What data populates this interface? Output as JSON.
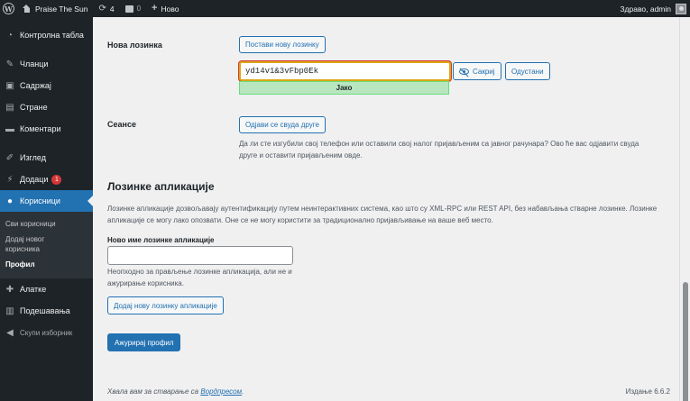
{
  "adminbar": {
    "site_name": "Praise The Sun",
    "updates_count": "4",
    "comments_count": "0",
    "new_label": "Ново",
    "greeting": "Здраво, admin"
  },
  "sidebar": {
    "dashboard": "Контролна табла",
    "posts": "Чланци",
    "media": "Садржај",
    "pages": "Стране",
    "comments": "Коментари",
    "appearance": "Изглед",
    "plugins": "Додаци",
    "plugins_badge": "1",
    "users": "Корисници",
    "submenu": {
      "all_users": "Сви корисници",
      "add_new": "Додај новог корисника",
      "profile": "Профил"
    },
    "tools": "Алатке",
    "settings": "Подешавања",
    "collapse": "Скупи изборник"
  },
  "content": {
    "new_password_label": "Нова лозинка",
    "set_new_password_button": "Постави нову лозинку",
    "password_value": "yd14v1&3vFbp0Ek",
    "hide_button": "Сакриј",
    "cancel_button": "Одустани",
    "strength_label": "Јако",
    "sessions_label": "Сеансе",
    "logout_everywhere_button": "Одјави се свуда друге",
    "sessions_desc": "Да ли сте изгубили свој телефон или оставили свој налог пријављеним са јавног рачунара? Ово ће вас одјавити свуда друге и оставити пријављеним овде.",
    "app_passwords_heading": "Лозинке апликације",
    "app_passwords_desc": "Лозинке апликације дозвољавају аутентификацију путем неинтерактивних система, као што су XML-RPC или REST API, без набављања стварне лозинке. Лозинке апликације се могу лако опозвати. Оне се не могу користити за традиционално пријављивање на ваше веб место.",
    "new_app_password_label": "Ново име лозинке апликације",
    "new_app_password_value": "",
    "new_app_password_hint": "Неопходно за прављење лозинке апликација, али не и ажурирање корисника.",
    "add_app_password_button": "Додај нову лозинку апликације",
    "update_profile_button": "Ажурирај профил"
  },
  "footer": {
    "thanks_prefix": "Хвала вам за стварање са ",
    "wordpress_link": "Вордпресом",
    "thanks_suffix": ".",
    "version": "Издање 6.6.2"
  },
  "colors": {
    "admin_dark": "#1d2327",
    "accent_blue": "#2271b1",
    "badge_red": "#d63638",
    "strength_green": "#b8e6bf"
  }
}
